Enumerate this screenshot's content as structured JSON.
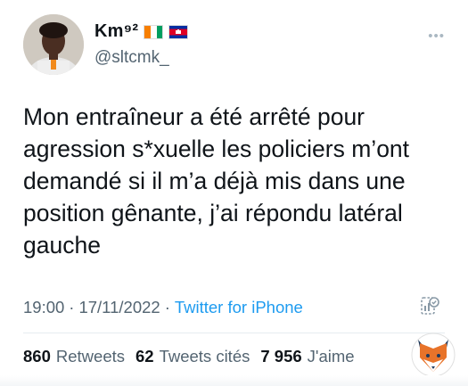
{
  "user": {
    "display_name": "Km⁹²",
    "handle": "@sltcmk_",
    "flags": [
      "flag-ivory-coast-icon",
      "flag-cambodia-icon"
    ]
  },
  "tweet": {
    "text": "Mon entraîneur a été arrêté pour\nagression s*xuelle les policiers m’ont\ndemandé si il m’a déjà mis dans une\nposition gênante, j’ai répondu latéral\ngauche",
    "time": "19:00",
    "date": "17/11/2022",
    "separator": "·",
    "source": "Twitter for iPhone"
  },
  "stats": {
    "retweets_count": "860",
    "retweets_label": "Retweets",
    "quotes_count": "62",
    "quotes_label": "Tweets cités",
    "likes_count": "7 956",
    "likes_label": "J'aime"
  },
  "icons": {
    "more": "more-options-icon",
    "analytics": "tweet-analytics-icon",
    "watermark": "fox-logo-icon"
  },
  "colors": {
    "link_blue": "#1d9bf0",
    "secondary_text": "#536471",
    "primary_text": "#0f1419"
  }
}
